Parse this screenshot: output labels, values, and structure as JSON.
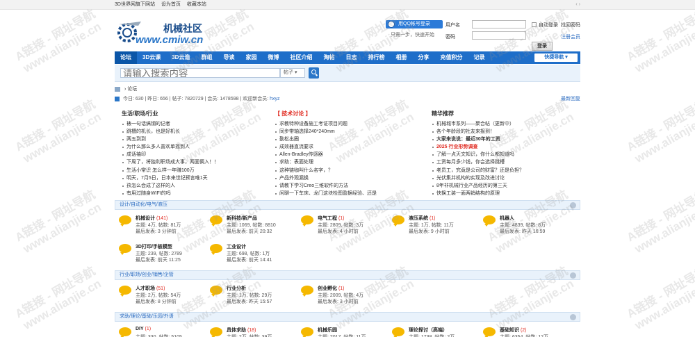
{
  "topbar": {
    "site_name": "3D世界网旗下网站",
    "set_home": "设为首页",
    "favorite": "收藏本站",
    "right": "‹ ›"
  },
  "logo": {
    "cn": "机械社区",
    "url": "www.cmiw.cn"
  },
  "qq": {
    "button": "用QQ帐号登录",
    "sub": "只需一步，快速开始"
  },
  "login": {
    "username_label": "用户名",
    "password_label": "密码",
    "username_value": "",
    "password_value": "",
    "auto_login": "自动登录",
    "forgot": "找回密码",
    "submit": "登录",
    "register": "注册会员"
  },
  "nav": {
    "items": [
      "论坛",
      "3D云课",
      "3D云造",
      "群组",
      "导读",
      "家园",
      "微博",
      "社区介绍",
      "淘帖",
      "日志",
      "排行榜",
      "相册",
      "分享",
      "充值积分",
      "记录"
    ],
    "quick": "快捷导航 ▾"
  },
  "search": {
    "placeholder": "请输入搜索内容",
    "type": "帖子 ▾"
  },
  "breadcrumb": {
    "sep": "›",
    "current": "论坛"
  },
  "stats": {
    "text": "今日: 630 | 昨日: 656 | 帖子: 7820729 | 会员: 1478598 | 欢迎新会员:",
    "new_member": "hxyz",
    "latest": "最新回复"
  },
  "columns": [
    {
      "title": "生活/职场/行业",
      "items": [
        {
          "t": "裱一句话搞钢的记者"
        },
        {
          "t": "跳槽的机长，也是好机长"
        },
        {
          "t": "两五到到"
        },
        {
          "t": "为什么那么多人喜欢单摇到人"
        },
        {
          "t": "成话袖印"
        },
        {
          "t": "下周了，将独利职场成大事，两面俩入！！"
        },
        {
          "t": "生活小常识 怎么样一年赚100万"
        },
        {
          "t": "明天，7月5日，日本来世纪预言唯1天"
        },
        {
          "t": "孩怎么会成了这样的人"
        },
        {
          "t": "有用过随身WIFI的吗"
        }
      ]
    },
    {
      "title": "【 技术讨论 】",
      "items": [
        {
          "t": "求教特种设备施工考证项目问题"
        },
        {
          "t": "同步带轴选择240*240mm"
        },
        {
          "t": "勤松出圈"
        },
        {
          "t": "成效器直流要求"
        },
        {
          "t": "Allen-Bradley传感器"
        },
        {
          "t": "求助：表面处理"
        },
        {
          "t": "这种链咖叫什么名字，？"
        },
        {
          "t": "产品外观漏换"
        },
        {
          "t": "请教下学习Creo三维软件的方法"
        },
        {
          "t": "闲聊一下车床、龙门这块检图盈据经验、还是"
        }
      ]
    },
    {
      "title": "精华推荐",
      "items": [
        {
          "t": "机械城市系列——聚合帖（更新中）"
        },
        {
          "t": "各个年龄段的社友来报到！"
        },
        {
          "t": "大家来说说：最近30年的工资",
          "s": "bold"
        },
        {
          "t": "2025 行业形势调查",
          "s": "red"
        },
        {
          "t": "了解一点天文知识，你什么都知道吗"
        },
        {
          "t": "工资每月多少钱，你会选择跳槽"
        },
        {
          "t": "老员工，究竟是公司的财富？还是负担？"
        },
        {
          "t": "光伏集并机构的实现及改进讨论"
        },
        {
          "t": "8年非机械行业产品经历的第三天"
        },
        {
          "t": "快换工装一面两销结构的原理"
        }
      ]
    }
  ],
  "sections": [
    {
      "title": "设计/自动化/电气/液压",
      "forums": [
        {
          "name": "机械设计",
          "count": "(141)",
          "l1": "主题: 4万, 帖数: 81万",
          "l2": "最后发表: 3 分钟前"
        },
        {
          "name": "新科技/新产品",
          "count": "",
          "l1": "主题: 1069, 帖数: 8810",
          "l2": "最后发表: 前天 20:32"
        },
        {
          "name": "电气工程",
          "count": "(1)",
          "l1": "主题: 2809, 帖数: 3万",
          "l2": "最后发表: 4 小时前"
        },
        {
          "name": "液压系统",
          "count": "(1)",
          "l1": "主题: 1万, 帖数: 11万",
          "l2": "最后发表: 9 小时前"
        },
        {
          "name": "机器人",
          "count": "",
          "l1": "主题: 4839, 帖数: 8万",
          "l2": "最后发表: 昨天 16:59"
        },
        {
          "name": "3D打印/手板模型",
          "count": "",
          "l1": "主题: 239, 帖数: 2789",
          "l2": "最后发表: 前天 11:25"
        },
        {
          "name": "工业设计",
          "count": "",
          "l1": "主题: 698, 帖数: 1万",
          "l2": "最后发表: 前天 14:41"
        }
      ]
    },
    {
      "title": "行业/职场/创业/销售/企管",
      "forums": [
        {
          "name": "人才职场",
          "count": "(51)",
          "l1": "主题: 2万, 帖数: 54万",
          "l2": "最后发表: 8 分钟前"
        },
        {
          "name": "行业分析",
          "count": "",
          "l1": "主题: 1万, 帖数: 29万",
          "l2": "最后发表: 昨天 15:57"
        },
        {
          "name": "创业孵化",
          "count": "(1)",
          "l1": "主题: 2009, 帖数: 4万",
          "l2": "最后发表: 3 小时前"
        }
      ]
    },
    {
      "title": "求助/理论/基础/乐园/外语",
      "forums": [
        {
          "name": "DIY",
          "count": "(1)",
          "l1": "主题: 330, 帖数: 5105",
          "l2": ""
        },
        {
          "name": "具体求助",
          "count": "(18)",
          "l1": "主题: 2万, 帖数: 39万",
          "l2": ""
        },
        {
          "name": "机械乐园",
          "count": "",
          "l1": "主题: 2017, 帖数: 11万",
          "l2": ""
        },
        {
          "name": "理论探讨（高端）",
          "count": "",
          "l1": "主题: 1738, 帖数: 2万",
          "l2": ""
        },
        {
          "name": "基础知识",
          "count": "(2)",
          "l1": "主题: 6354, 帖数: 12万",
          "l2": ""
        }
      ]
    }
  ],
  "watermark": {
    "line1": "A链接 - 网址导航",
    "line2": "www.alianjie.cn"
  }
}
